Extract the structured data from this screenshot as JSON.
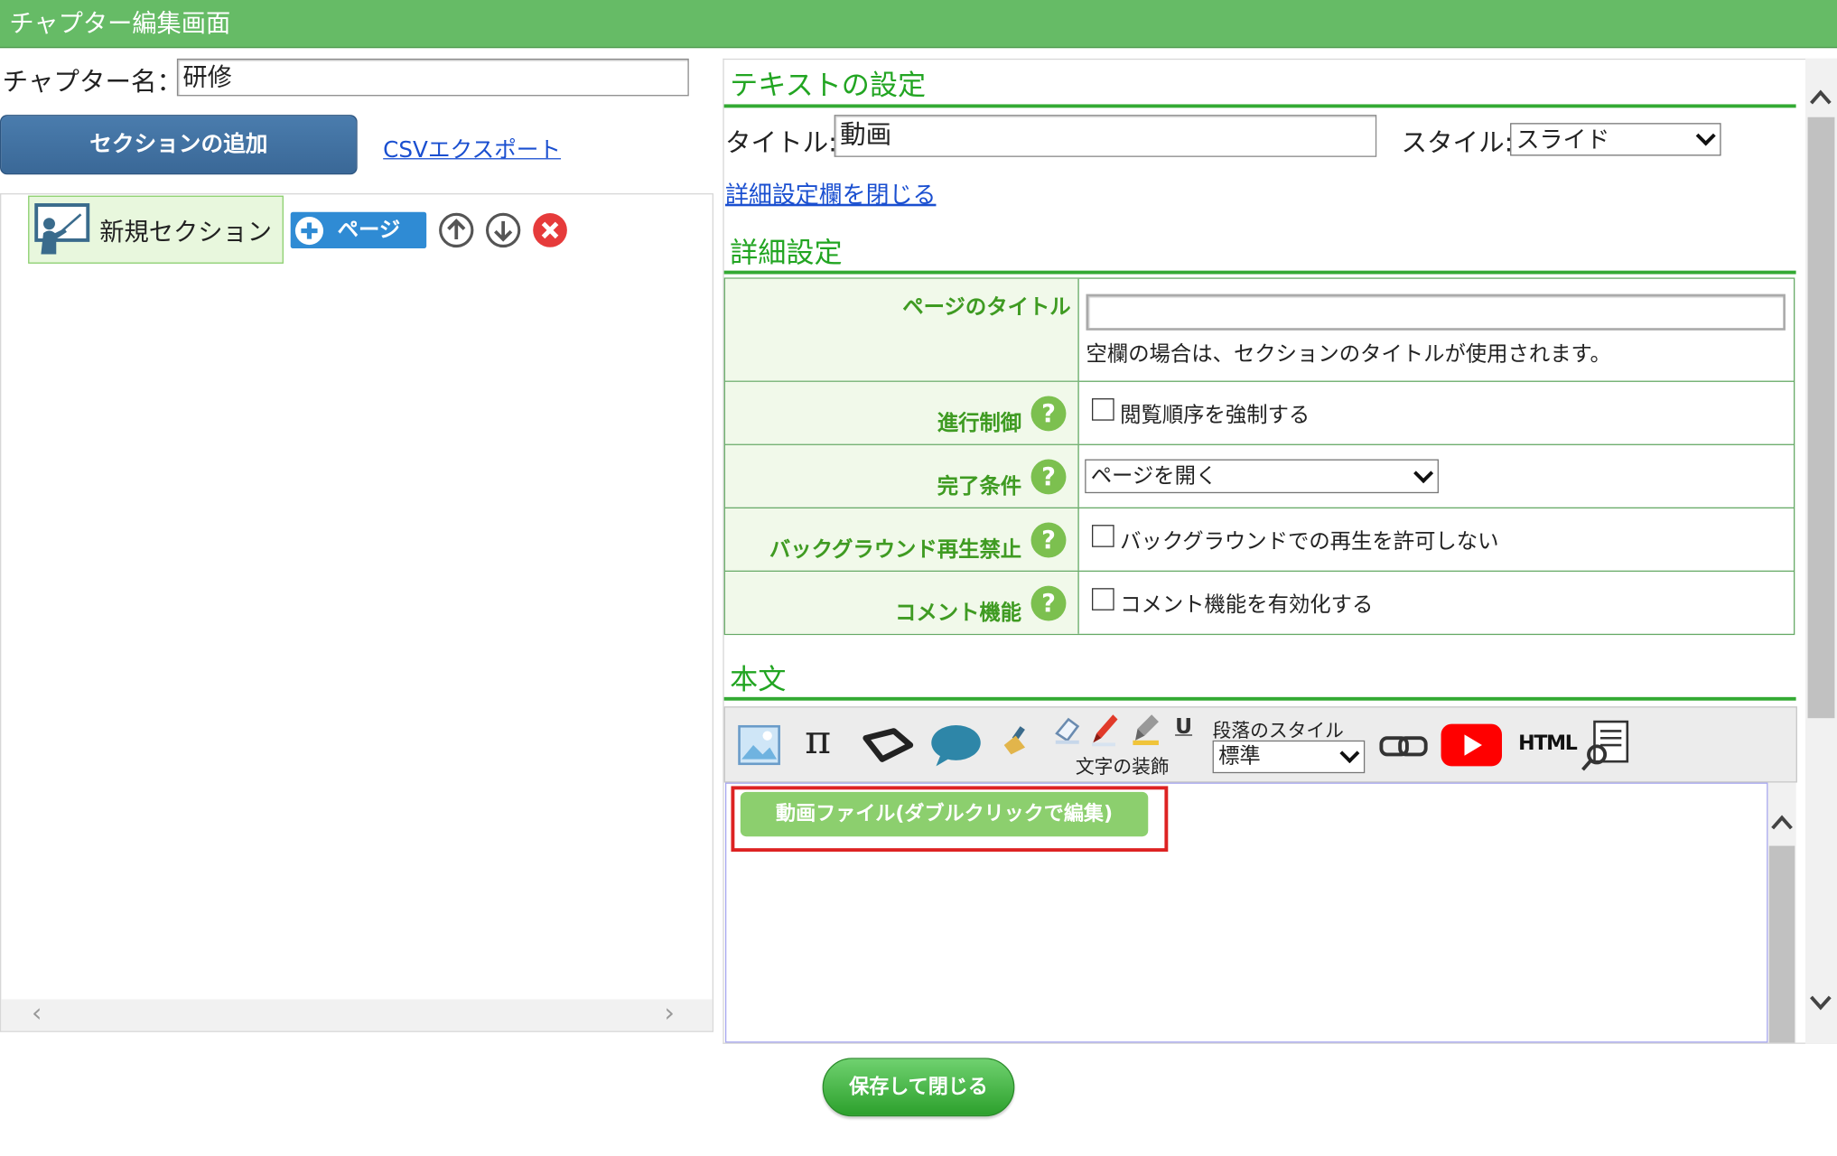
{
  "header": {
    "title": "チャプター編集画面"
  },
  "chapter": {
    "name_label": "チャプター名：",
    "name_value": "研修"
  },
  "left": {
    "add_section_button": "セクションの追加",
    "csv_export_link": "CSVエクスポート",
    "tree": {
      "section_label": "新規セクション",
      "add_page_button": "ページ",
      "scroll_left": "‹",
      "scroll_right": "›"
    }
  },
  "text_settings": {
    "heading": "テキストの設定",
    "title_label": "タイトル:",
    "title_value": "動画",
    "style_label": "スタイル:",
    "style_value": "スライド",
    "toggle_details_link": "詳細設定欄を閉じる"
  },
  "details": {
    "heading": "詳細設定",
    "rows": [
      {
        "label": "ページのタイトル",
        "input_value": "",
        "note": "空欄の場合は、セクションのタイトルが使用されます。"
      },
      {
        "label": "進行制御",
        "help": "?",
        "checkbox_label": "閲覧順序を強制する",
        "checked": false
      },
      {
        "label": "完了条件",
        "help": "?",
        "select_value": "ページを開く"
      },
      {
        "label": "バックグラウンド再生禁止",
        "help": "?",
        "checkbox_label": "バックグラウンドでの再生を許可しない",
        "checked": false
      },
      {
        "label": "コメント機能",
        "help": "?",
        "checkbox_label": "コメント機能を有効化する",
        "checked": false
      }
    ]
  },
  "body": {
    "heading": "本文",
    "toolbar": {
      "pi_symbol": "π",
      "underline_symbol": "U",
      "text_decoration_label": "文字の装飾",
      "paragraph_style_label": "段落のスタイル",
      "paragraph_style_value": "標準",
      "html_label": "HTML"
    },
    "video_block_label": "動画ファイル(ダブルクリックで編集)"
  },
  "footer": {
    "save_close_button": "保存して閉じる"
  },
  "colors": {
    "header": "#66bb66",
    "accent_green": "#33aa33",
    "blue_button": "#3a6897",
    "highlight_red": "#dd2222"
  }
}
